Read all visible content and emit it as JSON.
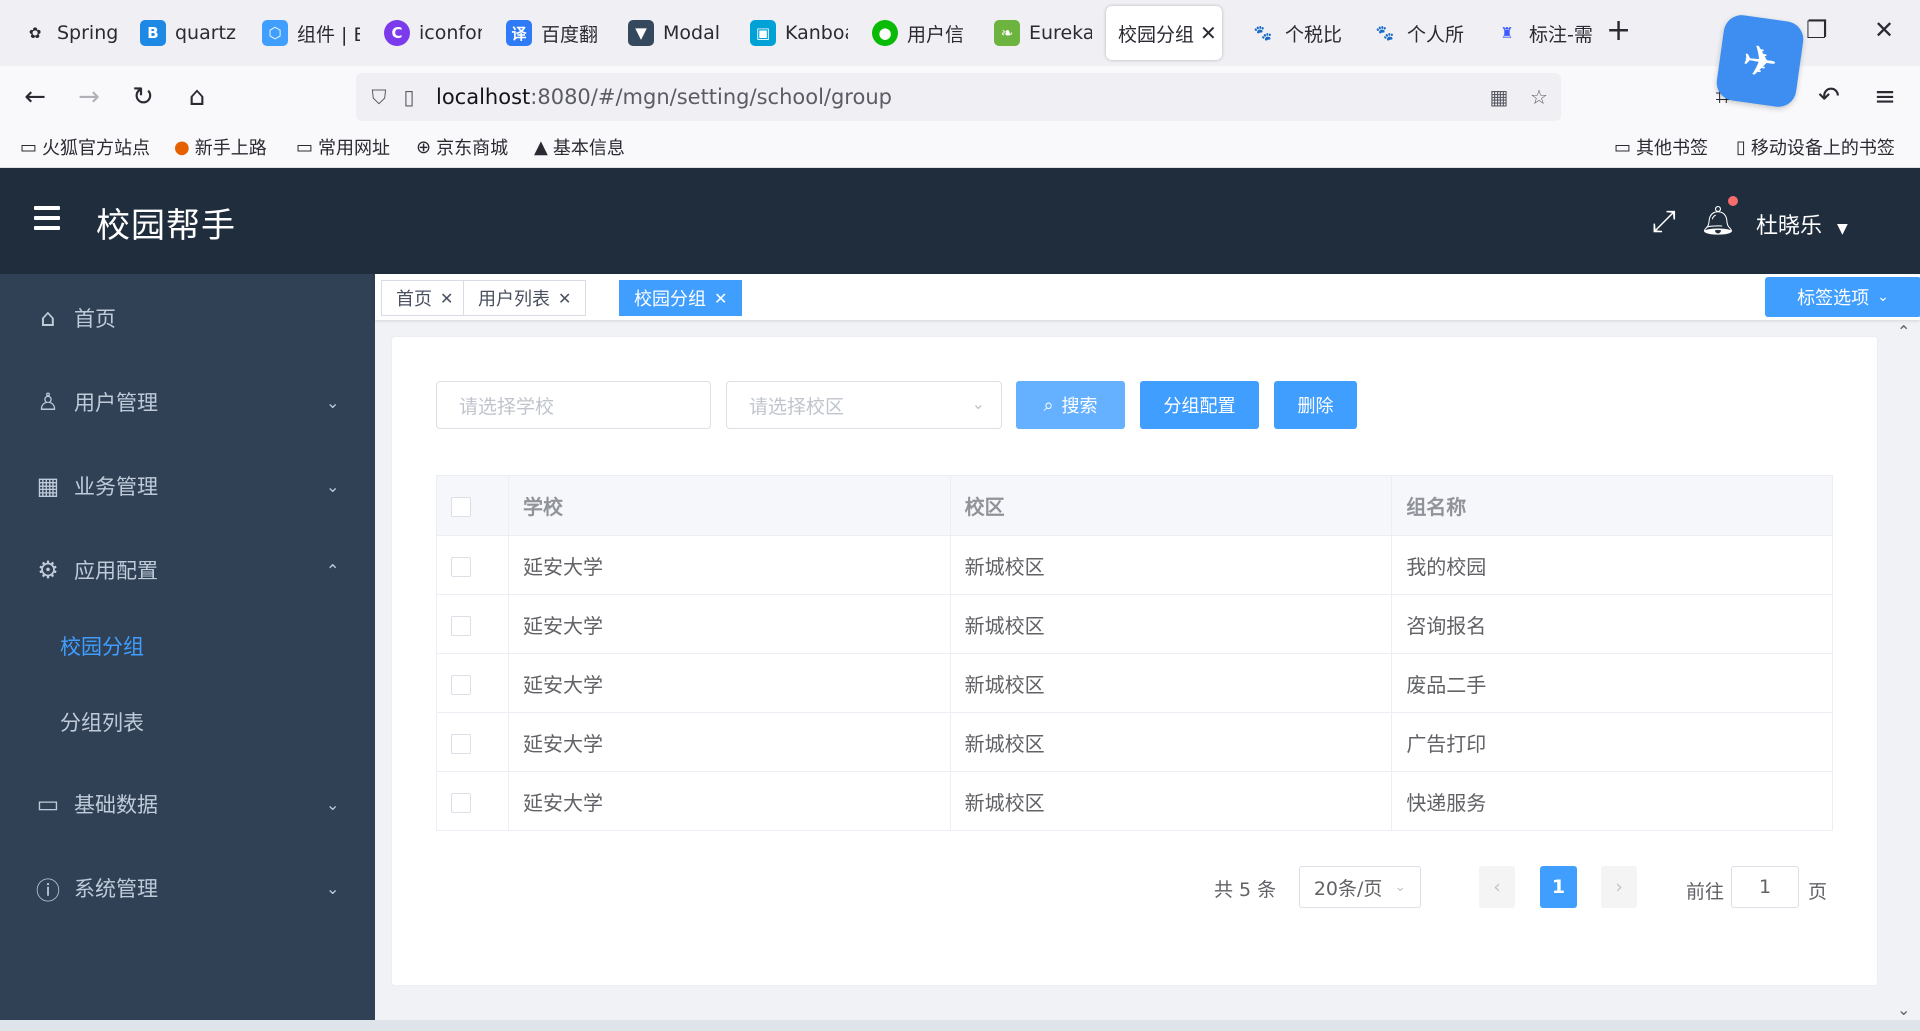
{
  "browser": {
    "tabs": [
      {
        "title": "Spring",
        "icon": "spring-leaf-icon",
        "color": "#2b2a33"
      },
      {
        "title": "quartz",
        "icon": "b-logo-icon",
        "color": "#1e88e5"
      },
      {
        "title": "组件 | E",
        "icon": "element-hexagon-icon",
        "color": "#409eff"
      },
      {
        "title": "iconfon",
        "icon": "iconfont-icon",
        "color": "#7c3aed"
      },
      {
        "title": "百度翻",
        "icon": "baidu-translate-icon",
        "color": "#2f7bf5"
      },
      {
        "title": "Modal",
        "icon": "vue-logo-icon",
        "color": "#34495e"
      },
      {
        "title": "Kanboa",
        "icon": "bilibili-icon",
        "color": "#00a1d6"
      },
      {
        "title": "用户信",
        "icon": "wechat-icon",
        "color": "#09bb07"
      },
      {
        "title": "Eureka",
        "icon": "spring-eureka-icon",
        "color": "#6db33f"
      },
      {
        "title": "校园分组",
        "icon": "",
        "color": "",
        "active": true
      },
      {
        "title": "个税比",
        "icon": "baidu-paw-icon",
        "color": "#2932e1"
      },
      {
        "title": "个人所",
        "icon": "baidu-paw-icon",
        "color": "#2932e1"
      },
      {
        "title": "标注-需",
        "icon": "rocket-icon",
        "color": "#3d5afe"
      }
    ],
    "url_host": "localhost",
    "url_path": ":8080/#/mgn/setting/school/group",
    "bookmarks_left": [
      {
        "label": "火狐官方站点",
        "icon": "folder-icon"
      },
      {
        "label": "新手上路",
        "icon": "firefox-icon"
      },
      {
        "label": "常用网址",
        "icon": "folder-icon"
      },
      {
        "label": "京东商城",
        "icon": "globe-icon"
      },
      {
        "label": "基本信息",
        "icon": "angular-icon"
      }
    ],
    "bookmarks_right": [
      {
        "label": "其他书签",
        "icon": "folder-icon"
      },
      {
        "label": "移动设备上的书签",
        "icon": "mobile-icon"
      }
    ]
  },
  "app": {
    "title": "校园帮手",
    "user": "杜晓乐",
    "accent": "#409eff",
    "header_bg": "#1f2d3d",
    "sidebar_bg": "#304156"
  },
  "sidebar": {
    "items": [
      {
        "label": "首页",
        "icon": "home-icon",
        "arrow": ""
      },
      {
        "label": "用户管理",
        "icon": "user-icon",
        "arrow": "down"
      },
      {
        "label": "业务管理",
        "icon": "grid-icon",
        "arrow": "down"
      },
      {
        "label": "应用配置",
        "icon": "gear-icon",
        "arrow": "up"
      },
      {
        "label": "校园分组",
        "icon": "",
        "arrow": "",
        "sub": true,
        "active": true
      },
      {
        "label": "分组列表",
        "icon": "",
        "arrow": "",
        "sub": true
      },
      {
        "label": "基础数据",
        "icon": "monitor-icon",
        "arrow": "down"
      },
      {
        "label": "系统管理",
        "icon": "alert-circle-icon",
        "arrow": "down"
      }
    ]
  },
  "tags": {
    "items": [
      {
        "label": "首页"
      },
      {
        "label": "用户列表"
      },
      {
        "label": "校园分组",
        "active": true
      }
    ],
    "options_label": "标签选项"
  },
  "filters": {
    "school_placeholder": "请选择学校",
    "campus_placeholder": "请选择校区",
    "search_label": "搜索",
    "config_label": "分组配置",
    "delete_label": "删除"
  },
  "table": {
    "columns": [
      "学校",
      "校区",
      "组名称"
    ],
    "rows": [
      [
        "延安大学",
        "新城校区",
        "我的校园"
      ],
      [
        "延安大学",
        "新城校区",
        "咨询报名"
      ],
      [
        "延安大学",
        "新城校区",
        "废品二手"
      ],
      [
        "延安大学",
        "新城校区",
        "广告打印"
      ],
      [
        "延安大学",
        "新城校区",
        "快递服务"
      ]
    ]
  },
  "pagination": {
    "total_text": "共 5 条",
    "page_size": "20条/页",
    "current_page": "1",
    "goto_label": "前往",
    "goto_value": "1",
    "page_unit": "页"
  }
}
